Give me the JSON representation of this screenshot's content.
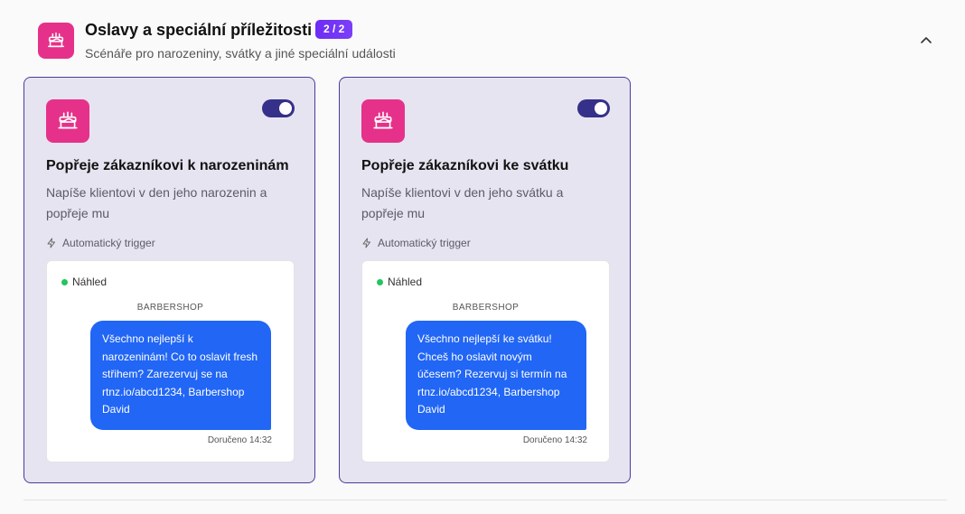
{
  "section": {
    "title": "Oslavy a speciální příležitosti",
    "badge": "2 / 2",
    "subtitle": "Scénáře pro narozeniny, svátky a jiné speciální události",
    "icon": "cake-icon",
    "collapse_icon": "chevron-up-icon"
  },
  "colors": {
    "accent_pink": "#e6318a",
    "toggle_on": "#35308a",
    "bubble_blue": "#2166f5",
    "badge_purple": "#6d2cf5",
    "preview_dot": "#22c55e"
  },
  "cards": [
    {
      "title": "Popřeje zákazníkovi k narozeninám",
      "description": "Napíše klientovi v den jeho narozenin a popřeje mu",
      "trigger": "Automatický trigger",
      "enabled": true,
      "preview": {
        "label": "Náhled",
        "sender": "BARBERSHOP",
        "message": "Všechno nejlepší k narozeninám! Co to oslavit fresh střihem? Zarezervuj se na rtnz.io/abcd1234, Barbershop David",
        "status": "Doručeno 14:32"
      }
    },
    {
      "title": "Popřeje zákazníkovi ke svátku",
      "description": "Napíše klientovi v den jeho svátku a popřeje mu",
      "trigger": "Automatický trigger",
      "enabled": true,
      "preview": {
        "label": "Náhled",
        "sender": "BARBERSHOP",
        "message": "Všechno nejlepší ke svátku! Chceš ho oslavit novým účesem? Rezervuj si termín na rtnz.io/abcd1234, Barbershop David",
        "status": "Doručeno 14:32"
      }
    }
  ]
}
